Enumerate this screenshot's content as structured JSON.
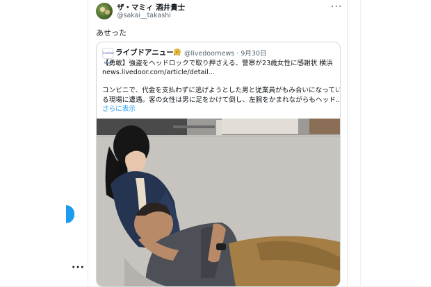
{
  "tweet": {
    "display_name": "ザ・マミィ 酒井貴士",
    "handle": "@sakai__takashi",
    "text": "あせった",
    "more_label": "···"
  },
  "quote": {
    "name": "ライブドアニュース",
    "handle_date": "@livedoornews · 9月30日",
    "avatar_text": "livedoor News",
    "lines": [
      "【勇敢】強盗をヘッドロックで取り押さえる、警察が23歳女性に感謝状 横浜",
      "news.livedoor.com/article/detail...",
      "",
      "コンビニで、代金を支払わずに逃げようとした男と従業員がもみ合いになってい",
      "る現場に遭遇。客の女性は男に足をかけて倒し、左腕をかまれながらもヘッド..."
    ],
    "show_more": "さらに表示"
  },
  "left_more": "···",
  "colors": {
    "accent": "#1d9bf0",
    "text": "#0f1419",
    "muted": "#536471",
    "border": "#cfd9de"
  },
  "icons": {
    "verified": "gold-verified-badge-icon",
    "more": "more-horizontal-icon"
  }
}
